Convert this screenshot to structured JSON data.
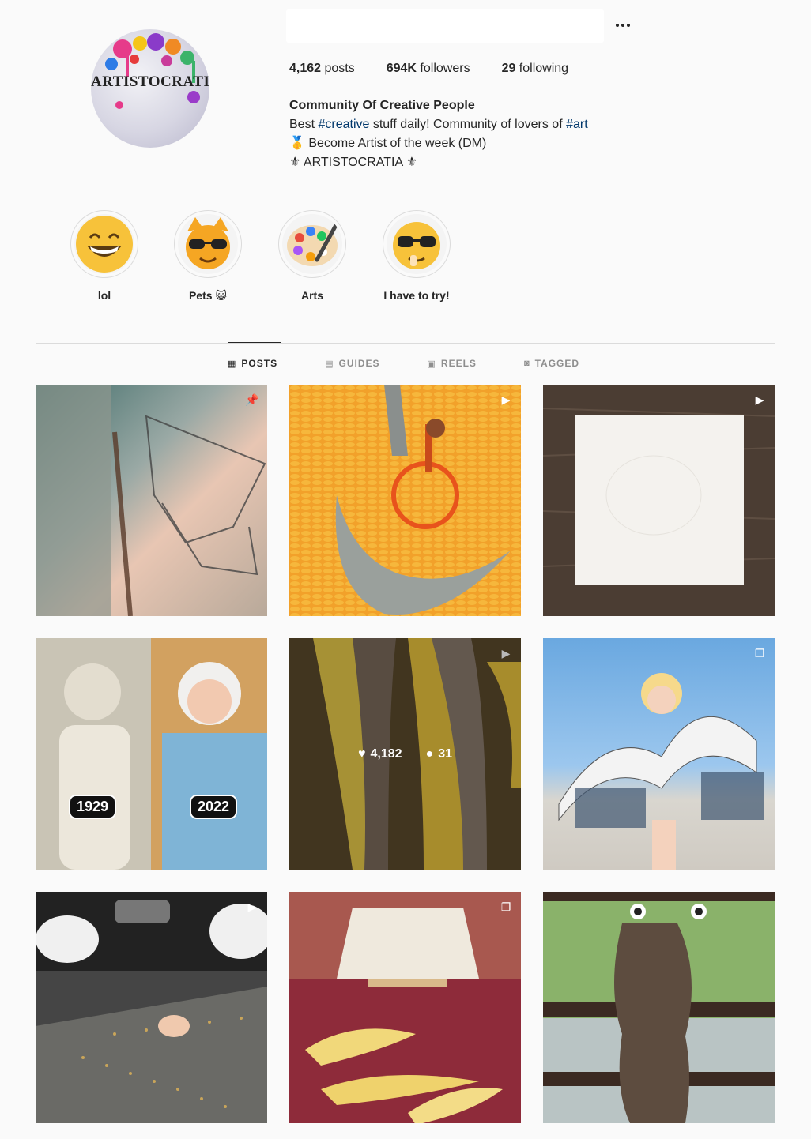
{
  "profile": {
    "avatar_text": "ARTISTOCRATIA",
    "posts_count": "4,162",
    "posts_label": " posts",
    "followers_count": "694K",
    "followers_label": " followers",
    "following_count": "29",
    "following_label": " following",
    "more_icon": "ellipsis-icon"
  },
  "bio": {
    "name": "Community Of Creative People",
    "line1_pre": "Best ",
    "line1_tag1": "#creative",
    "line1_mid": " stuff daily! Community of lovers of ",
    "line1_tag2": "#art",
    "line2": "🥇 Become Artist of the week (DM)",
    "line3": "⚜ ARTISTOCRATIA ⚜"
  },
  "highlights": [
    {
      "label": "lol",
      "icon": "😄"
    },
    {
      "label": "Pets 😺",
      "icon": "😼"
    },
    {
      "label": "Arts",
      "icon": "🎨"
    },
    {
      "label": "I have to try!",
      "icon": "🤓"
    }
  ],
  "tabs": [
    {
      "label": "POSTS",
      "icon": "grid-icon",
      "active": true
    },
    {
      "label": "GUIDES",
      "icon": "guide-icon",
      "active": false
    },
    {
      "label": "REELS",
      "icon": "reels-icon",
      "active": false
    },
    {
      "label": "TAGGED",
      "icon": "tagged-icon",
      "active": false
    }
  ],
  "posts": [
    {
      "badge": "pin-icon"
    },
    {
      "badge": "reel-icon"
    },
    {
      "badge": "reel-icon"
    },
    {
      "badge": "",
      "years": [
        "1929",
        "2022"
      ]
    },
    {
      "badge": "reel-icon",
      "likes": "4,182",
      "comments": "31"
    },
    {
      "badge": "carousel-icon"
    },
    {
      "badge": "reel-icon"
    },
    {
      "badge": "carousel-icon"
    },
    {
      "badge": ""
    }
  ]
}
